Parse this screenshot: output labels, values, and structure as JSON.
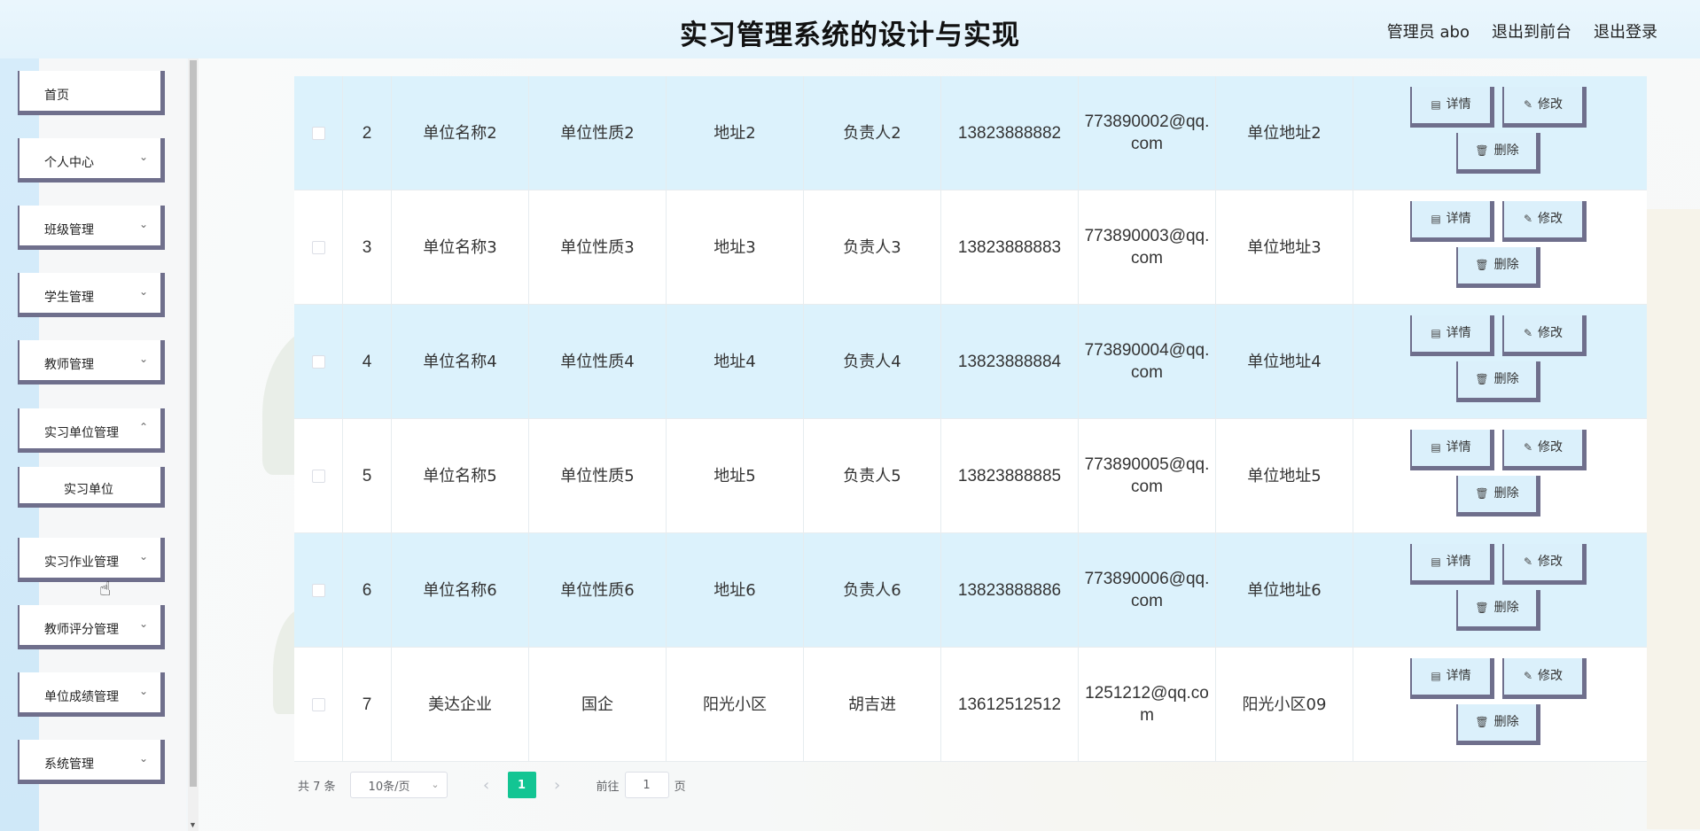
{
  "header": {
    "title": "实习管理系统的设计与实现",
    "user": "管理员 abo",
    "back_front": "退出到前台",
    "logout": "退出登录"
  },
  "sidebar": {
    "items": [
      {
        "label": "首页"
      },
      {
        "label": "个人中心"
      },
      {
        "label": "班级管理"
      },
      {
        "label": "学生管理"
      },
      {
        "label": "教师管理"
      },
      {
        "label": "实习单位管理"
      },
      {
        "label": "实习单位"
      },
      {
        "label": "实习作业管理"
      },
      {
        "label": "教师评分管理"
      },
      {
        "label": "单位成绩管理"
      },
      {
        "label": "系统管理"
      }
    ]
  },
  "table": {
    "rows": [
      {
        "idx": "2",
        "name": "单位名称2",
        "nature": "单位性质2",
        "address": "地址2",
        "leader": "负责人2",
        "phone": "13823888882",
        "email": "773890002@qq.com",
        "unit_address": "单位地址2"
      },
      {
        "idx": "3",
        "name": "单位名称3",
        "nature": "单位性质3",
        "address": "地址3",
        "leader": "负责人3",
        "phone": "13823888883",
        "email": "773890003@qq.com",
        "unit_address": "单位地址3"
      },
      {
        "idx": "4",
        "name": "单位名称4",
        "nature": "单位性质4",
        "address": "地址4",
        "leader": "负责人4",
        "phone": "13823888884",
        "email": "773890004@qq.com",
        "unit_address": "单位地址4"
      },
      {
        "idx": "5",
        "name": "单位名称5",
        "nature": "单位性质5",
        "address": "地址5",
        "leader": "负责人5",
        "phone": "13823888885",
        "email": "773890005@qq.com",
        "unit_address": "单位地址5"
      },
      {
        "idx": "6",
        "name": "单位名称6",
        "nature": "单位性质6",
        "address": "地址6",
        "leader": "负责人6",
        "phone": "13823888886",
        "email": "773890006@qq.com",
        "unit_address": "单位地址6"
      },
      {
        "idx": "7",
        "name": "美达企业",
        "nature": "国企",
        "address": "阳光小区",
        "leader": "胡吉进",
        "phone": "13612512512",
        "email": "1251212@qq.com",
        "unit_address": "阳光小区09"
      }
    ],
    "actions": {
      "detail": "详情",
      "edit": "修改",
      "delete": "删除"
    }
  },
  "pagination": {
    "total": "共 7 条",
    "page_size": "10条/页",
    "current_page": "1",
    "goto_label": "前往",
    "goto_value": "1",
    "page_unit": "页"
  }
}
